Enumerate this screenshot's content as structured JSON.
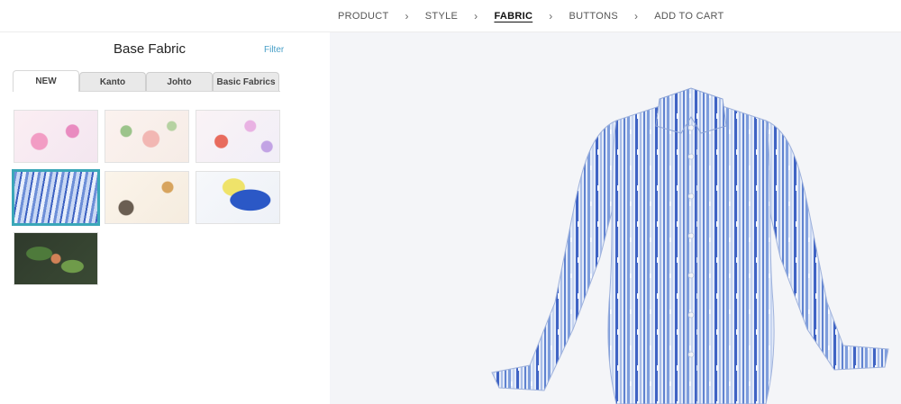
{
  "breadcrumb": {
    "steps": [
      "PRODUCT",
      "STYLE",
      "FABRIC",
      "BUTTONS",
      "ADD TO CART"
    ],
    "active": "FABRIC"
  },
  "panel": {
    "title": "Base Fabric",
    "filter_label": "Filter",
    "tabs": [
      "NEW",
      "Kanto",
      "Johto",
      "Basic Fabrics"
    ],
    "active_tab": "NEW",
    "swatches": [
      {
        "pattern": "pink-tree-character-print",
        "selected": false
      },
      {
        "pattern": "green-floral-character-print",
        "selected": false
      },
      {
        "pattern": "red-bunny-character-print",
        "selected": false
      },
      {
        "pattern": "blue-stripe-print",
        "selected": true
      },
      {
        "pattern": "cream-critters-print",
        "selected": false
      },
      {
        "pattern": "blue-yellow-character-print",
        "selected": false
      },
      {
        "pattern": "dark-jungle-leaf-print",
        "selected": false
      }
    ]
  },
  "preview": {
    "garment": "long-sleeve-button-shirt",
    "fabric": "blue-stripe-print",
    "colors": {
      "light_stripe": "#c6d4f0",
      "mid_stripe": "#7e9ddc",
      "dark_stripe": "#3f63c4",
      "button": "#f2f4f8",
      "background": "#f4f5f8"
    }
  },
  "colors": {
    "accent": "#4aa0c8",
    "selected_outline": "#3aa7b8"
  }
}
